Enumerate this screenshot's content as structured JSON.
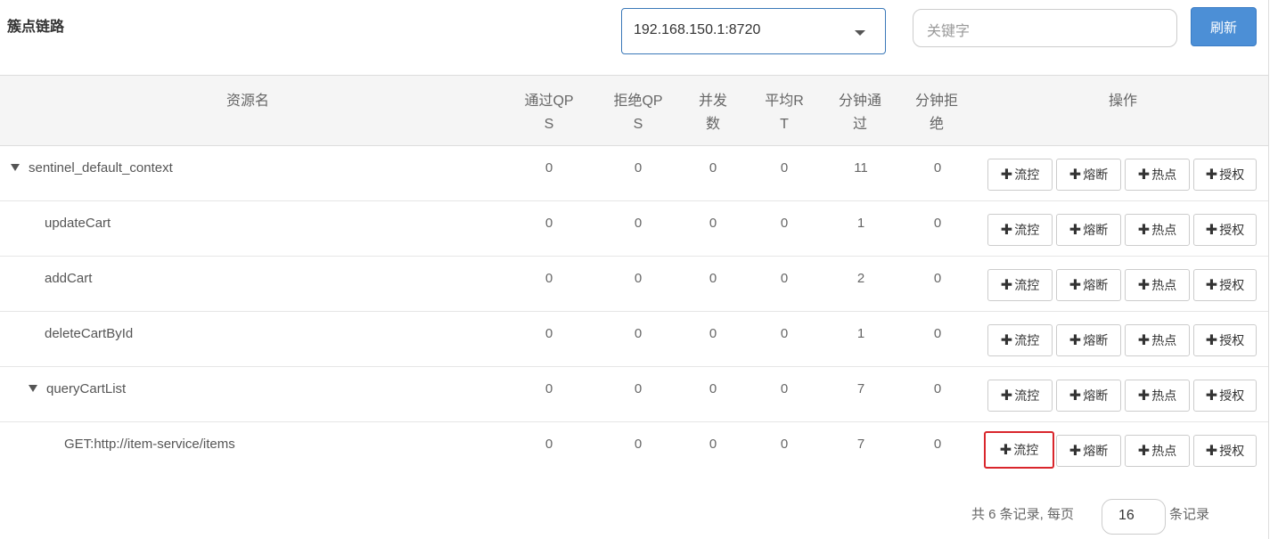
{
  "header": {
    "title": "簇点链路",
    "machine_select": "192.168.150.1:8720",
    "search_placeholder": "关键字",
    "refresh_label": "刷新"
  },
  "table": {
    "columns": [
      "资源名",
      "通过QPS",
      "拒绝QPS",
      "并发数",
      "平均RT",
      "分钟通过",
      "分钟拒绝",
      "操作"
    ],
    "column_lines": [
      [
        "资源名"
      ],
      [
        "通过QP",
        "S"
      ],
      [
        "拒绝QP",
        "S"
      ],
      [
        "并发",
        "数"
      ],
      [
        "平均R",
        "T"
      ],
      [
        "分钟通",
        "过"
      ],
      [
        "分钟拒",
        "绝"
      ],
      [
        "操作"
      ]
    ],
    "rows": [
      {
        "name": "sentinel_default_context",
        "expanded": true,
        "pass_qps": "0",
        "block_qps": "0",
        "concurrency": "0",
        "avg_rt": "0",
        "min_pass": "11",
        "min_block": "0"
      },
      {
        "name": "updateCart",
        "pass_qps": "0",
        "block_qps": "0",
        "concurrency": "0",
        "avg_rt": "0",
        "min_pass": "1",
        "min_block": "0"
      },
      {
        "name": "addCart",
        "pass_qps": "0",
        "block_qps": "0",
        "concurrency": "0",
        "avg_rt": "0",
        "min_pass": "2",
        "min_block": "0"
      },
      {
        "name": "deleteCartById",
        "pass_qps": "0",
        "block_qps": "0",
        "concurrency": "0",
        "avg_rt": "0",
        "min_pass": "1",
        "min_block": "0"
      },
      {
        "name": "queryCartList",
        "expanded": true,
        "pass_qps": "0",
        "block_qps": "0",
        "concurrency": "0",
        "avg_rt": "0",
        "min_pass": "7",
        "min_block": "0"
      },
      {
        "name": "GET:http://item-service/items",
        "pass_qps": "0",
        "block_qps": "0",
        "concurrency": "0",
        "avg_rt": "0",
        "min_pass": "7",
        "min_block": "0"
      }
    ],
    "actions": {
      "flow": "流控",
      "degrade": "熔断",
      "hotspot": "热点",
      "authority": "授权"
    }
  },
  "pager": {
    "total_text": "共 6 条记录, 每页",
    "page_size": "16",
    "suffix": "条记录"
  },
  "colors": {
    "accent": "#4c8fd6",
    "highlight": "#d9262c"
  }
}
